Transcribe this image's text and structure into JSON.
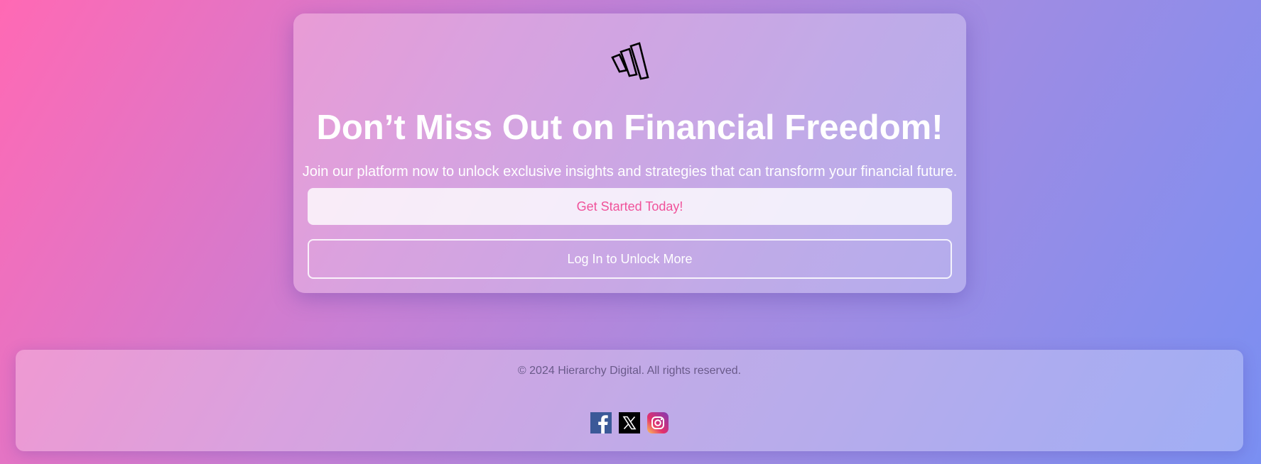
{
  "hero": {
    "title": "Don’t Miss Out on Financial Freedom!",
    "subtitle": "Join our platform now to unlock exclusive insights and strategies that can transform your financial future.",
    "primary_button": "Get Started Today!",
    "secondary_button": "Log In to Unlock More",
    "logo_icon": "hierarchy-digital-logo-icon"
  },
  "footer": {
    "copyright": "© 2024 Hierarchy Digital. All rights reserved.",
    "socials": [
      {
        "name": "facebook-icon"
      },
      {
        "name": "x-twitter-icon"
      },
      {
        "name": "instagram-icon"
      }
    ]
  },
  "colors": {
    "accent": "#f0529a",
    "background_start": "#ff69b4",
    "background_end": "#7a8ff2"
  }
}
